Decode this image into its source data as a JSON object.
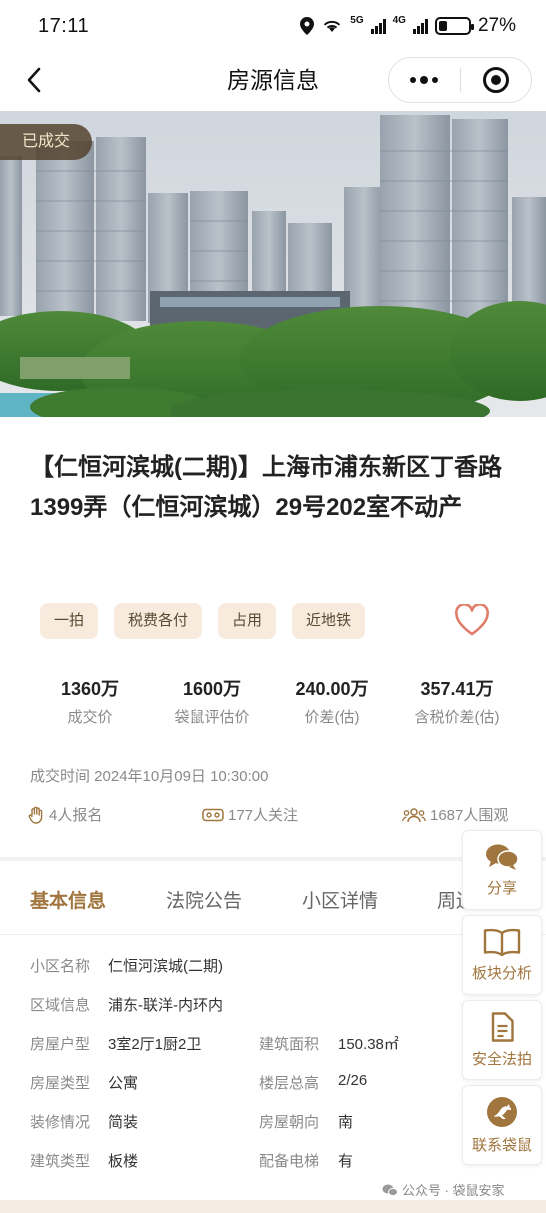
{
  "status_bar": {
    "time": "17:11",
    "network_5g": "5G",
    "network_4g": "4G",
    "battery_percent": "27%",
    "battery_level": 0.27
  },
  "nav": {
    "title": "房源信息"
  },
  "hero": {
    "status_badge": "已成交"
  },
  "listing": {
    "title": "【仁恒河滨城(二期)】上海市浦东新区丁香路1399弄（仁恒河滨城）29号202室不动产",
    "tags": [
      "一拍",
      "税费各付",
      "占用",
      "近地铁"
    ]
  },
  "stats": [
    {
      "value": "1360万",
      "label": "成交价"
    },
    {
      "value": "1600万",
      "label": "袋鼠评估价"
    },
    {
      "value": "240.00万",
      "label": "价差(估)"
    },
    {
      "value": "357.41万",
      "label": "含税价差(估)"
    }
  ],
  "deal_time": "成交时间 2024年10月09日 10:30:00",
  "meta": {
    "signups": "4人报名",
    "followers": "177人关注",
    "watchers": "1687人围观"
  },
  "tabs": [
    "基本信息",
    "法院公告",
    "小区详情",
    "周边"
  ],
  "basic_info": {
    "community": {
      "label": "小区名称",
      "value": "仁恒河滨城(二期)"
    },
    "region": {
      "label": "区域信息",
      "value": "浦东-联洋-内环内"
    },
    "layout": {
      "label": "房屋户型",
      "value": "3室2厅1厨2卫"
    },
    "area": {
      "label": "建筑面积",
      "value": "150.38㎡"
    },
    "house_type": {
      "label": "房屋类型",
      "value": "公寓"
    },
    "floor": {
      "label": "楼层总高",
      "value": "2/26"
    },
    "decoration": {
      "label": "装修情况",
      "value": "简装"
    },
    "orientation": {
      "label": "房屋朝向",
      "value": "南"
    },
    "building_type": {
      "label": "建筑类型",
      "value": "板楼"
    },
    "elevator": {
      "label": "配备电梯",
      "value": "有"
    }
  },
  "float_panel": {
    "share": "分享",
    "analysis": "板块分析",
    "safety": "安全法拍",
    "contact": "联系袋鼠"
  },
  "watermark": "公众号 · 袋鼠安家",
  "colors": {
    "accent": "#a0753e",
    "tag_bg": "#f8ebdd",
    "heart": "#e07d6a"
  }
}
